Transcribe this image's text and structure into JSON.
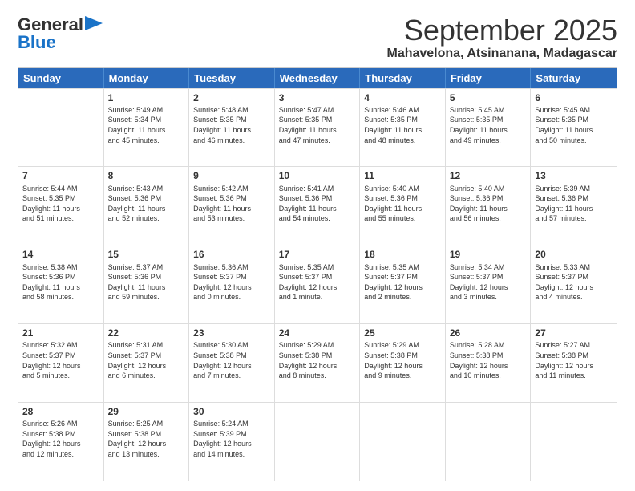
{
  "header": {
    "logo_line1": "General",
    "logo_line2": "Blue",
    "month": "September 2025",
    "location": "Mahavelona, Atsinanana, Madagascar"
  },
  "weekdays": [
    "Sunday",
    "Monday",
    "Tuesday",
    "Wednesday",
    "Thursday",
    "Friday",
    "Saturday"
  ],
  "weeks": [
    [
      {
        "day": "",
        "info": ""
      },
      {
        "day": "1",
        "info": "Sunrise: 5:49 AM\nSunset: 5:34 PM\nDaylight: 11 hours\nand 45 minutes."
      },
      {
        "day": "2",
        "info": "Sunrise: 5:48 AM\nSunset: 5:35 PM\nDaylight: 11 hours\nand 46 minutes."
      },
      {
        "day": "3",
        "info": "Sunrise: 5:47 AM\nSunset: 5:35 PM\nDaylight: 11 hours\nand 47 minutes."
      },
      {
        "day": "4",
        "info": "Sunrise: 5:46 AM\nSunset: 5:35 PM\nDaylight: 11 hours\nand 48 minutes."
      },
      {
        "day": "5",
        "info": "Sunrise: 5:45 AM\nSunset: 5:35 PM\nDaylight: 11 hours\nand 49 minutes."
      },
      {
        "day": "6",
        "info": "Sunrise: 5:45 AM\nSunset: 5:35 PM\nDaylight: 11 hours\nand 50 minutes."
      }
    ],
    [
      {
        "day": "7",
        "info": "Sunrise: 5:44 AM\nSunset: 5:35 PM\nDaylight: 11 hours\nand 51 minutes."
      },
      {
        "day": "8",
        "info": "Sunrise: 5:43 AM\nSunset: 5:36 PM\nDaylight: 11 hours\nand 52 minutes."
      },
      {
        "day": "9",
        "info": "Sunrise: 5:42 AM\nSunset: 5:36 PM\nDaylight: 11 hours\nand 53 minutes."
      },
      {
        "day": "10",
        "info": "Sunrise: 5:41 AM\nSunset: 5:36 PM\nDaylight: 11 hours\nand 54 minutes."
      },
      {
        "day": "11",
        "info": "Sunrise: 5:40 AM\nSunset: 5:36 PM\nDaylight: 11 hours\nand 55 minutes."
      },
      {
        "day": "12",
        "info": "Sunrise: 5:40 AM\nSunset: 5:36 PM\nDaylight: 11 hours\nand 56 minutes."
      },
      {
        "day": "13",
        "info": "Sunrise: 5:39 AM\nSunset: 5:36 PM\nDaylight: 11 hours\nand 57 minutes."
      }
    ],
    [
      {
        "day": "14",
        "info": "Sunrise: 5:38 AM\nSunset: 5:36 PM\nDaylight: 11 hours\nand 58 minutes."
      },
      {
        "day": "15",
        "info": "Sunrise: 5:37 AM\nSunset: 5:36 PM\nDaylight: 11 hours\nand 59 minutes."
      },
      {
        "day": "16",
        "info": "Sunrise: 5:36 AM\nSunset: 5:37 PM\nDaylight: 12 hours\nand 0 minutes."
      },
      {
        "day": "17",
        "info": "Sunrise: 5:35 AM\nSunset: 5:37 PM\nDaylight: 12 hours\nand 1 minute."
      },
      {
        "day": "18",
        "info": "Sunrise: 5:35 AM\nSunset: 5:37 PM\nDaylight: 12 hours\nand 2 minutes."
      },
      {
        "day": "19",
        "info": "Sunrise: 5:34 AM\nSunset: 5:37 PM\nDaylight: 12 hours\nand 3 minutes."
      },
      {
        "day": "20",
        "info": "Sunrise: 5:33 AM\nSunset: 5:37 PM\nDaylight: 12 hours\nand 4 minutes."
      }
    ],
    [
      {
        "day": "21",
        "info": "Sunrise: 5:32 AM\nSunset: 5:37 PM\nDaylight: 12 hours\nand 5 minutes."
      },
      {
        "day": "22",
        "info": "Sunrise: 5:31 AM\nSunset: 5:37 PM\nDaylight: 12 hours\nand 6 minutes."
      },
      {
        "day": "23",
        "info": "Sunrise: 5:30 AM\nSunset: 5:38 PM\nDaylight: 12 hours\nand 7 minutes."
      },
      {
        "day": "24",
        "info": "Sunrise: 5:29 AM\nSunset: 5:38 PM\nDaylight: 12 hours\nand 8 minutes."
      },
      {
        "day": "25",
        "info": "Sunrise: 5:29 AM\nSunset: 5:38 PM\nDaylight: 12 hours\nand 9 minutes."
      },
      {
        "day": "26",
        "info": "Sunrise: 5:28 AM\nSunset: 5:38 PM\nDaylight: 12 hours\nand 10 minutes."
      },
      {
        "day": "27",
        "info": "Sunrise: 5:27 AM\nSunset: 5:38 PM\nDaylight: 12 hours\nand 11 minutes."
      }
    ],
    [
      {
        "day": "28",
        "info": "Sunrise: 5:26 AM\nSunset: 5:38 PM\nDaylight: 12 hours\nand 12 minutes."
      },
      {
        "day": "29",
        "info": "Sunrise: 5:25 AM\nSunset: 5:38 PM\nDaylight: 12 hours\nand 13 minutes."
      },
      {
        "day": "30",
        "info": "Sunrise: 5:24 AM\nSunset: 5:39 PM\nDaylight: 12 hours\nand 14 minutes."
      },
      {
        "day": "",
        "info": ""
      },
      {
        "day": "",
        "info": ""
      },
      {
        "day": "",
        "info": ""
      },
      {
        "day": "",
        "info": ""
      }
    ]
  ]
}
